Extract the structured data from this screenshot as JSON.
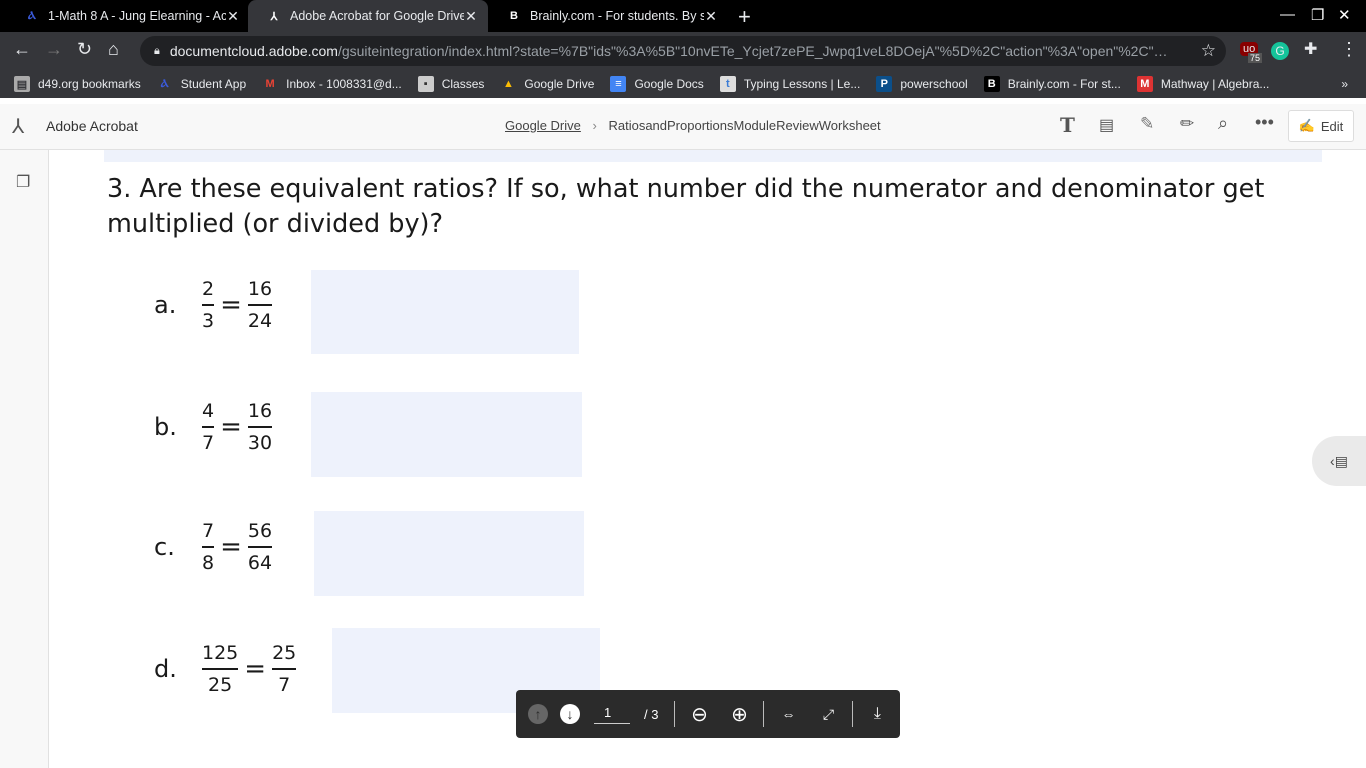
{
  "browser": {
    "tabs": [
      {
        "title": "1-Math 8 A - Jung Elearning - Ac",
        "icon": "canvas-icon"
      },
      {
        "title": "Adobe Acrobat for Google Drive",
        "icon": "acrobat-icon"
      },
      {
        "title": "Brainly.com - For students. By st",
        "icon": "brainly-icon"
      }
    ],
    "url_domain": "documentcloud.adobe.com",
    "url_path": "/gsuiteintegration/index.html?state=%7B\"ids\"%3A%5B\"10nvETe_Ycjet7zePE_Jwpq1veL8DOejA\"%5D%2C\"action\"%3A\"open\"%2C\"userId\"...",
    "extension_badge": "75",
    "bookmarks": [
      "d49.org bookmarks",
      "Student App",
      "Inbox - 1008331@d...",
      "Classes",
      "Google Drive",
      "Google Docs",
      "Typing Lessons | Le...",
      "powerschool",
      "Brainly.com - For st...",
      "Mathway | Algebra..."
    ]
  },
  "acrobat": {
    "app_name": "Adobe Acrobat",
    "breadcrumb_root": "Google Drive",
    "file_name": "RatiosandProportionsModuleReviewWorksheet",
    "edit_label": "Edit"
  },
  "document": {
    "question": "3. Are these equivalent ratios? If so, what number did the numerator and denominator get multiplied (or divided by)?",
    "items": [
      {
        "label": "a.",
        "n1": "2",
        "d1": "3",
        "n2": "16",
        "d2": "24"
      },
      {
        "label": "b.",
        "n1": "4",
        "d1": "7",
        "n2": "16",
        "d2": "30"
      },
      {
        "label": "c.",
        "n1": "7",
        "d1": "8",
        "n2": "56",
        "d2": "64"
      },
      {
        "label": "d.",
        "n1": "125",
        "d1": "25",
        "n2": "25",
        "d2": "7"
      }
    ],
    "equals": "="
  },
  "pager": {
    "current_page": "1",
    "total": "/ 3"
  }
}
